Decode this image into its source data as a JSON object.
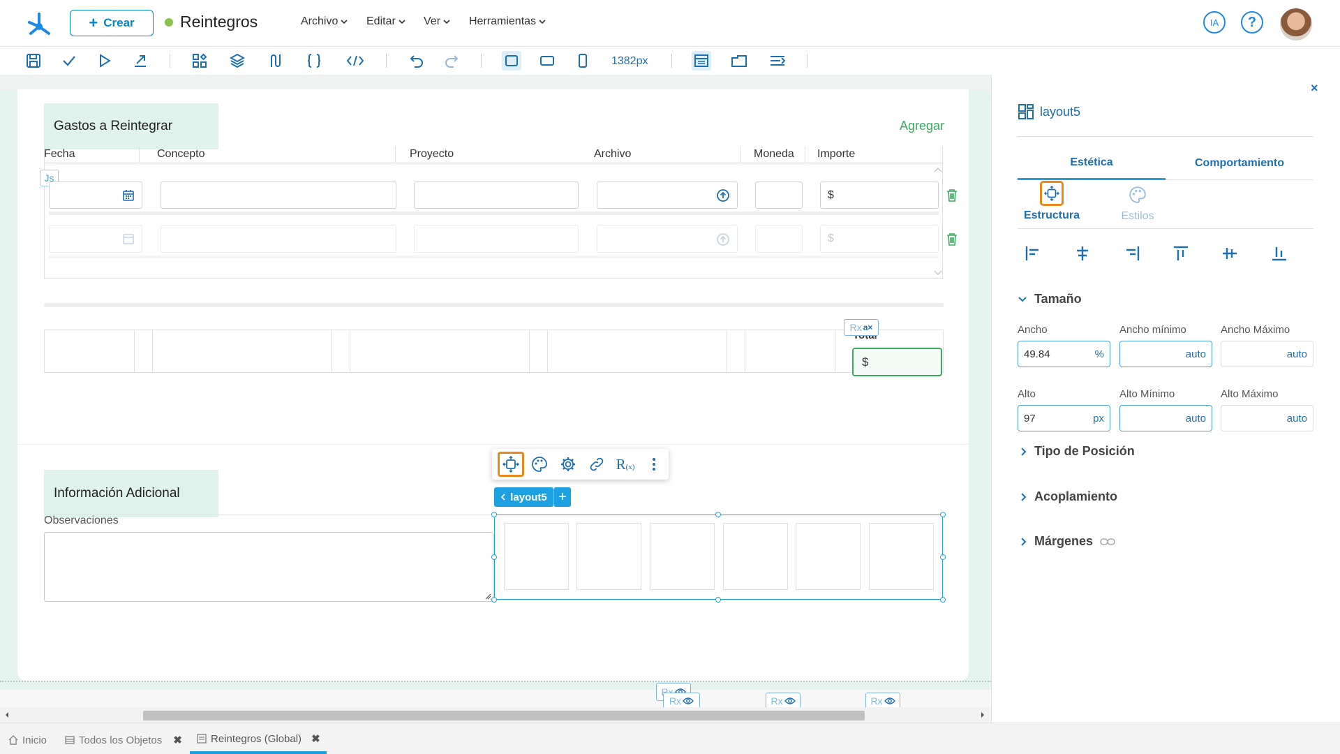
{
  "header": {
    "create_label": "Crear",
    "app_title": "Reintegros",
    "menus": [
      "Archivo",
      "Editar",
      "Ver",
      "Herramientas"
    ],
    "ia_label": "IA"
  },
  "toolbar": {
    "width_readout": "1382px"
  },
  "form": {
    "section1_title": "Gastos a Reintegrar",
    "add_link": "Agregar",
    "columns": [
      "Fecha",
      "Concepto",
      "Proyecto",
      "Archivo",
      "Moneda",
      "Importe"
    ],
    "currency_symbol": "$",
    "js_badge": "Js",
    "rx_label": "Rx",
    "total_label": "Total",
    "total_value": "$",
    "section2_title": "Información Adicional",
    "observations_label": "Observaciones",
    "layout_chip": "layout5"
  },
  "panel": {
    "component_name": "layout5",
    "tabs": [
      "Estética",
      "Comportamiento"
    ],
    "subtabs": [
      "Estructura",
      "Estilos"
    ],
    "size_section": "Tamaño",
    "fields": {
      "ancho_label": "Ancho",
      "ancho_value": "49.84",
      "ancho_unit": "%",
      "ancho_min_label": "Ancho mínimo",
      "ancho_min_value": "auto",
      "ancho_max_label": "Ancho Máximo",
      "ancho_max_value": "auto",
      "alto_label": "Alto",
      "alto_value": "97",
      "alto_unit": "px",
      "alto_min_label": "Alto Mínimo",
      "alto_min_value": "auto",
      "alto_max_label": "Alto Máximo",
      "alto_max_value": "auto"
    },
    "sections": [
      "Tipo de Posición",
      "Acoplamiento",
      "Márgenes"
    ]
  },
  "bottom_tabs": [
    "Inicio",
    "Todos los Objetos",
    "Reintegros (Global)"
  ],
  "colors": {
    "accent": "#0089c7",
    "green": "#3aaa5e",
    "highlight_orange": "#e8891b",
    "selection_blue": "#1da1e2"
  }
}
